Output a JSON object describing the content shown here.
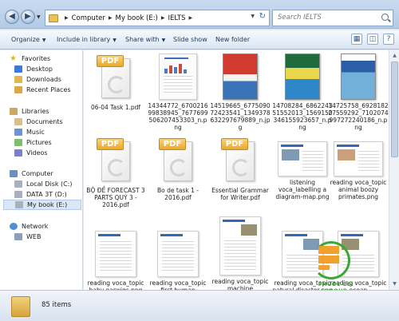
{
  "address": {
    "crumbs": [
      "Computer",
      "My book (E:)",
      "IELTS"
    ],
    "search_placeholder": "Search IELTS"
  },
  "toolbar": {
    "organize": "Organize",
    "include": "Include in library",
    "share": "Share with",
    "slideshow": "Slide show",
    "newfolder": "New folder"
  },
  "sidebar": {
    "favorites": "Favorites",
    "desktop": "Desktop",
    "downloads": "Downloads",
    "recent": "Recent Places",
    "libraries": "Libraries",
    "documents": "Documents",
    "music": "Music",
    "pictures": "Pictures",
    "videos": "Videos",
    "computer": "Computer",
    "local_disk": "Local Disk (C:)",
    "data": "DATA 3T (D:)",
    "mybook": "My book (E:)",
    "network": "Network",
    "web": "WEB"
  },
  "files": [
    {
      "name": "06-04 Task 1.pdf",
      "icon": "pdf-icon"
    },
    {
      "name": "14344772_670021699838945_7677699506207453303_n.png",
      "icon": "image-icon"
    },
    {
      "name": "14519665_677509072423541_1349378632297679889_n.jpg",
      "icon": "book-cover-icon"
    },
    {
      "name": "14708284_686224351552013_1569150346155923657_n.png",
      "icon": "book-cover-icon"
    },
    {
      "name": "14725758_692818227559292_7102074997272240186_n.png",
      "icon": "book-cover-icon"
    },
    {
      "name": "BỘ ĐỀ FORECAST 3 PARTS QUÝ 3 - 2016.pdf",
      "icon": "pdf-icon"
    },
    {
      "name": "Bo de task 1 - 2016.pdf",
      "icon": "pdf-icon"
    },
    {
      "name": "Essential Grammar for Writer.pdf",
      "icon": "pdf-icon"
    },
    {
      "name": "listening voca_labelling a diagram-map.png",
      "icon": "image-icon"
    },
    {
      "name": "reading voca_topic animal boozy primates.png",
      "icon": "image-icon"
    },
    {
      "name": "reading voca_topic baby earwigs.png",
      "icon": "image-icon"
    },
    {
      "name": "reading voca_topic first human trial.png",
      "icon": "image-icon"
    },
    {
      "name": "reading voca_topic machine intelligence.png",
      "icon": "image-icon"
    },
    {
      "name": "reading voca_topic natural disaster.png",
      "icon": "image-icon"
    },
    {
      "name": "reading voca_topic ocean protection.png",
      "icon": "image-icon"
    }
  ],
  "watermark": "PHUOC LOI GROUP",
  "status": {
    "count": "85 items"
  },
  "colors": {
    "pdf_badge": "#e9a92d",
    "selection": "#dbe7f6",
    "watermark_green": "#39a935",
    "watermark_orange": "#f39a1d"
  }
}
